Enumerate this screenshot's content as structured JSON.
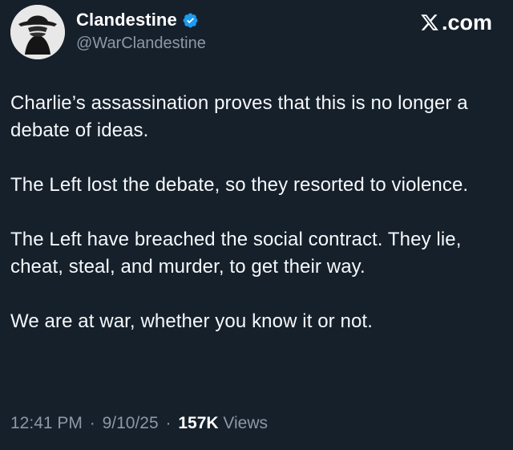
{
  "author": {
    "display_name": "Clandestine",
    "handle": "@WarClandestine",
    "verified": true,
    "avatar_icon": "fedora-figure-icon"
  },
  "brand": {
    "text": ".com",
    "icon": "x-logo-icon"
  },
  "tweet": {
    "paragraphs": [
      "Charlie’s assassination proves that this is no longer a debate of ideas.",
      "The Left lost the debate, so they resorted to violence.",
      "The Left have breached the social contract. They lie, cheat, steal, and murder, to get their way.",
      "We are at war, whether you know it or not."
    ]
  },
  "meta": {
    "time": "12:41 PM",
    "separator": "·",
    "date": "9/10/25",
    "views_count": "157K",
    "views_label": "Views"
  },
  "colors": {
    "background": "#16202b",
    "text_primary": "#f5f8fa",
    "text_secondary": "#8b98a5",
    "verified_badge": "#1d9bf0"
  }
}
